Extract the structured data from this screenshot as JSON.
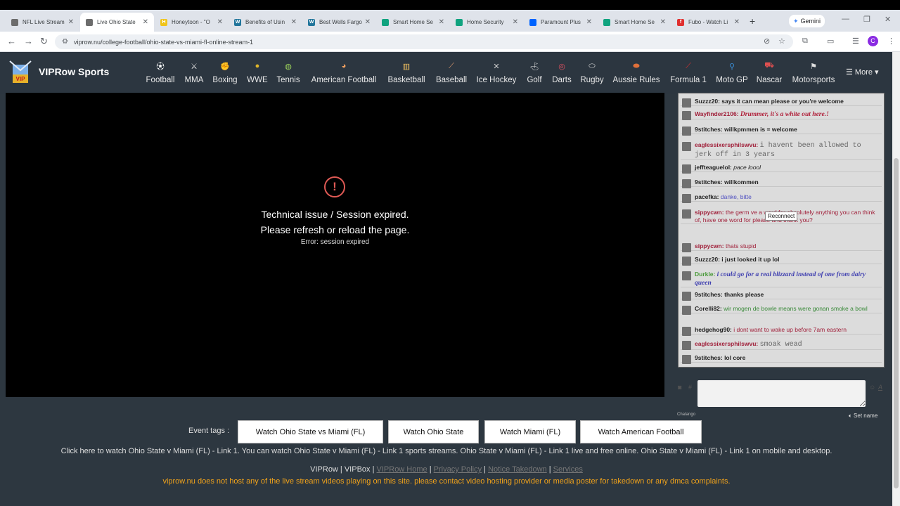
{
  "browser": {
    "tabs": [
      {
        "title": "NFL Live Stream",
        "color": "#6c6c6c",
        "glyph": ""
      },
      {
        "title": "Live Ohio State",
        "color": "#6c6c6c",
        "glyph": ""
      },
      {
        "title": "Honeytoon - \"O",
        "color": "#f0c419",
        "glyph": "H"
      },
      {
        "title": "Benefits of Usin",
        "color": "#21759b",
        "glyph": "W"
      },
      {
        "title": "Best Wells Fargo",
        "color": "#21759b",
        "glyph": "W"
      },
      {
        "title": "Smart Home Se",
        "color": "#10a37f",
        "glyph": ""
      },
      {
        "title": "Home Security",
        "color": "#10a37f",
        "glyph": ""
      },
      {
        "title": "Paramount Plus",
        "color": "#0064ff",
        "glyph": ""
      },
      {
        "title": "Smart Home Se",
        "color": "#10a37f",
        "glyph": ""
      },
      {
        "title": "Fubo - Watch Li",
        "color": "#e0302f",
        "glyph": "f"
      }
    ],
    "gemini_label": "Gemini",
    "url": "viprow.nu/college-football/ohio-state-vs-miami-fl-online-stream-1",
    "profile_initial": "C"
  },
  "site": {
    "brand": "VIPRow Sports",
    "logo_text": "VIP",
    "sports": [
      {
        "label": "Football",
        "icon": "soccer-ball-icon",
        "color": "#ffffff"
      },
      {
        "label": "MMA",
        "icon": "mma-fighter-icon",
        "color": "#e0e0e0"
      },
      {
        "label": "Boxing",
        "icon": "boxing-glove-icon",
        "color": "#e94f7a"
      },
      {
        "label": "WWE",
        "icon": "wwe-belt-icon",
        "color": "#e0b629"
      },
      {
        "label": "Tennis",
        "icon": "tennis-racket-icon",
        "color": "#9bd15a"
      },
      {
        "label": "American Football",
        "icon": "football-helmet-icon",
        "color": "#f0a060"
      },
      {
        "label": "Basketball",
        "icon": "basketball-hoop-icon",
        "color": "#f0c060"
      },
      {
        "label": "Baseball",
        "icon": "baseball-bat-icon",
        "color": "#e8a070"
      },
      {
        "label": "Ice Hockey",
        "icon": "hockey-sticks-icon",
        "color": "#d0d0d0"
      },
      {
        "label": "Golf",
        "icon": "golf-icon",
        "color": "#e0e0e0"
      },
      {
        "label": "Darts",
        "icon": "dartboard-icon",
        "color": "#e05060"
      },
      {
        "label": "Rugby",
        "icon": "rugby-ball-icon",
        "color": "#e8e8e8"
      },
      {
        "label": "Aussie Rules",
        "icon": "aussie-rules-ball-icon",
        "color": "#e0703a"
      },
      {
        "label": "Formula 1",
        "icon": "f1-car-icon",
        "color": "#e03030"
      },
      {
        "label": "Moto GP",
        "icon": "motorbike-icon",
        "color": "#3a8ad0"
      },
      {
        "label": "Nascar",
        "icon": "race-car-icon",
        "color": "#e05050"
      },
      {
        "label": "Motorsports",
        "icon": "checkered-flags-icon",
        "color": "#e0e0e0"
      }
    ],
    "more_label": "More"
  },
  "player": {
    "error_line1": "Technical issue / Session expired.",
    "error_line2": "Please refresh or reload the page.",
    "error_detail": "Error: session expired",
    "error_color": "#e05a55"
  },
  "chat": {
    "reconnect_label": "Reconnect",
    "messages": [
      {
        "user": "Suzzz20:",
        "text": "says it can mean please or you're welcome",
        "user_color": "#222222",
        "text_color": "#222222",
        "style": "bold"
      },
      {
        "user": "Wayfinder2106:",
        "text": "Drummer, it's a white out here.!",
        "user_color": "#a0203a",
        "text_color": "#b0203a",
        "style": "bold-italic-serif"
      },
      {
        "user": "9stitches:",
        "text": "willkpmmen is = welcome",
        "user_color": "#222222",
        "text_color": "#222222",
        "style": "bold"
      },
      {
        "user": "eaglessixersphilswvu:",
        "text": "i havent been allowed to jerk off in 3 years",
        "user_color": "#a0203a",
        "text_color": "#666666",
        "style": "mono"
      },
      {
        "user": "jeffteaguelol:",
        "text": "pace loool",
        "user_color": "#222222",
        "text_color": "#222222",
        "style": "italic"
      },
      {
        "user": "9stitches:",
        "text": "willkommen",
        "user_color": "#222222",
        "text_color": "#222222",
        "style": "bold"
      },
      {
        "user": "pacefka:",
        "text": "danke, bitte",
        "user_color": "#222222",
        "text_color": "#5050c0",
        "style": "normal"
      },
      {
        "user": "sippycwn:",
        "text": "the germ        ve a word for absolutely anything you can think of, have one word for please and thank you?",
        "user_color": "#a0203a",
        "text_color": "#a0203a",
        "style": "normal"
      },
      {
        "user": "sippycwn:",
        "text": "thats stupid",
        "user_color": "#a0203a",
        "text_color": "#a0203a",
        "style": "normal"
      },
      {
        "user": "Suzzz20:",
        "text": "i just looked it up lol",
        "user_color": "#222222",
        "text_color": "#222222",
        "style": "bold"
      },
      {
        "user": "Durkle:",
        "text": "i could go for a real blizzard instead of one from dairy queen",
        "user_color": "#4a9a3a",
        "text_color": "#4040b0",
        "style": "bold-italic-serif"
      },
      {
        "user": "9stitches:",
        "text": "thanks please",
        "user_color": "#222222",
        "text_color": "#222222",
        "style": "bold"
      },
      {
        "user": "Corelli82:",
        "text": "wir mogen de bowle means were gonan smoke a bowl",
        "user_color": "#222222",
        "text_color": "#3a8a3a",
        "style": "normal"
      },
      {
        "user": "hedgehog90:",
        "text": "i dont want to wake up before 7am eastern",
        "user_color": "#222222",
        "text_color": "#a0203a",
        "style": "normal"
      },
      {
        "user": "eaglessixersphilswvu:",
        "text": "smoak wead",
        "user_color": "#a0203a",
        "text_color": "#666666",
        "style": "mono"
      },
      {
        "user": "9stitches:",
        "text": "lol core",
        "user_color": "#222222",
        "text_color": "#222222",
        "style": "bold"
      }
    ],
    "brand": "Chatango",
    "set_name": "Set name"
  },
  "footer": {
    "tags_label": "Event tags :",
    "tags": [
      "Watch Ohio State vs Miami (FL)",
      "Watch Ohio State",
      "Watch Miami (FL)",
      "Watch American Football"
    ],
    "promo": "Click here to watch Ohio State v Miami (FL) - Link 1. You can watch Ohio State v Miami (FL) - Link 1 sports streams. Ohio State v Miami (FL) - Link 1 live and free online. Ohio State v Miami (FL) - Link 1 on mobile and desktop.",
    "brand_line": "VIPRow | VIPBox |",
    "links": [
      "VIPRow Home",
      "Privacy Policy",
      "Notice Takedown",
      "Services"
    ],
    "disclaimer": "viprow.nu does not host any of the live stream videos playing on this site. please contact video hosting provider or media poster for takedown or any dmca complaints."
  }
}
